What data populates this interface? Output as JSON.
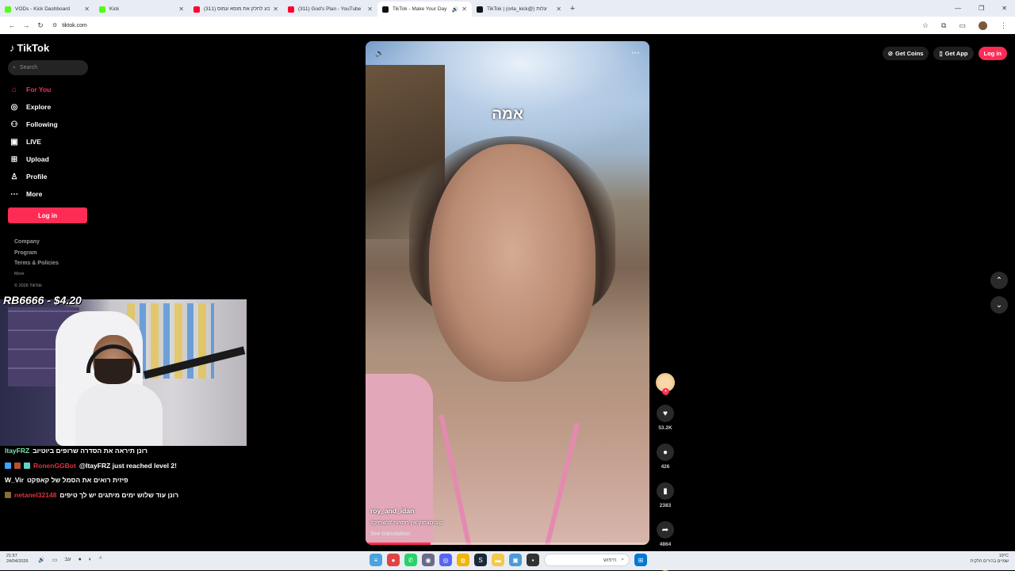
{
  "browser": {
    "tabs": [
      {
        "title": "VODs - Kick Dashboard",
        "color": "#53fc18"
      },
      {
        "title": "Kick",
        "color": "#53fc18"
      },
      {
        "title": "(311) עדן פוגל תבע לחלק את מוסא עמוס",
        "color": "#ff0033"
      },
      {
        "title": "(311) God's Plan - YouTube",
        "color": "#ff0033"
      },
      {
        "title": "TikTok - Make Your Day",
        "color": "#111111",
        "active": true
      },
      {
        "title": "TikTok | (orla_kick@) עלות",
        "color": "#111111"
      }
    ],
    "url": "tiktok.com"
  },
  "tiktok": {
    "logo": "TikTok",
    "search_placeholder": "Search",
    "nav": [
      {
        "label": "For You",
        "icon": "home-icon",
        "glyph": "⌂"
      },
      {
        "label": "Explore",
        "icon": "compass-icon",
        "glyph": "◎"
      },
      {
        "label": "Following",
        "icon": "following-icon",
        "glyph": "⚇"
      },
      {
        "label": "LIVE",
        "icon": "live-icon",
        "glyph": "▣"
      },
      {
        "label": "Upload",
        "icon": "upload-icon",
        "glyph": "⊞"
      },
      {
        "label": "Profile",
        "icon": "profile-icon",
        "glyph": "♙"
      },
      {
        "label": "More",
        "icon": "more-icon",
        "glyph": "⋯"
      }
    ],
    "login_label": "Log in",
    "footer": {
      "company": "Company",
      "program": "Program",
      "terms": "Terms & Policies",
      "more": "More",
      "copyright": "© 2026 TikTok"
    },
    "top_right": {
      "coins": "Get Coins",
      "app": "Get App",
      "login": "Log in"
    },
    "video": {
      "caption": "אמה",
      "author": "roy_and_idan",
      "description": "#קוביםצחוק אין חסויות #מצחיק",
      "see_translation": "See translation",
      "progress": 0.23
    },
    "actions": {
      "likes": "53.2K",
      "comments": "426",
      "saves": "2383",
      "shares": "4864"
    }
  },
  "stream": {
    "donation": "RB6666 - $4.20",
    "chat": [
      {
        "user": "ItayFRZ",
        "user_color": "#7fe0b0",
        "message": "רונן תיראה את הסדרה שרופים ביוטיוב"
      },
      {
        "user": "RonenGGBot",
        "user_color": "#e0323c",
        "message": "@ItayFRZ just reached level 2!",
        "mention": "@ItayFRZ"
      },
      {
        "user": "W_Vir",
        "user_color": "#ffffff",
        "message": "פיזית רואים את הסמל של קאפקט"
      },
      {
        "user": "netanel32148",
        "user_color": "#e0323c",
        "message": "רונן עוד שלוש ימים מיתגים יש לך טיפים"
      }
    ]
  },
  "taskbar": {
    "time": "21:57",
    "date": "24/04/2026",
    "search_label": "חיפוש",
    "weather": "19°C",
    "weather_desc": "שמיים בהירים חלקית"
  }
}
